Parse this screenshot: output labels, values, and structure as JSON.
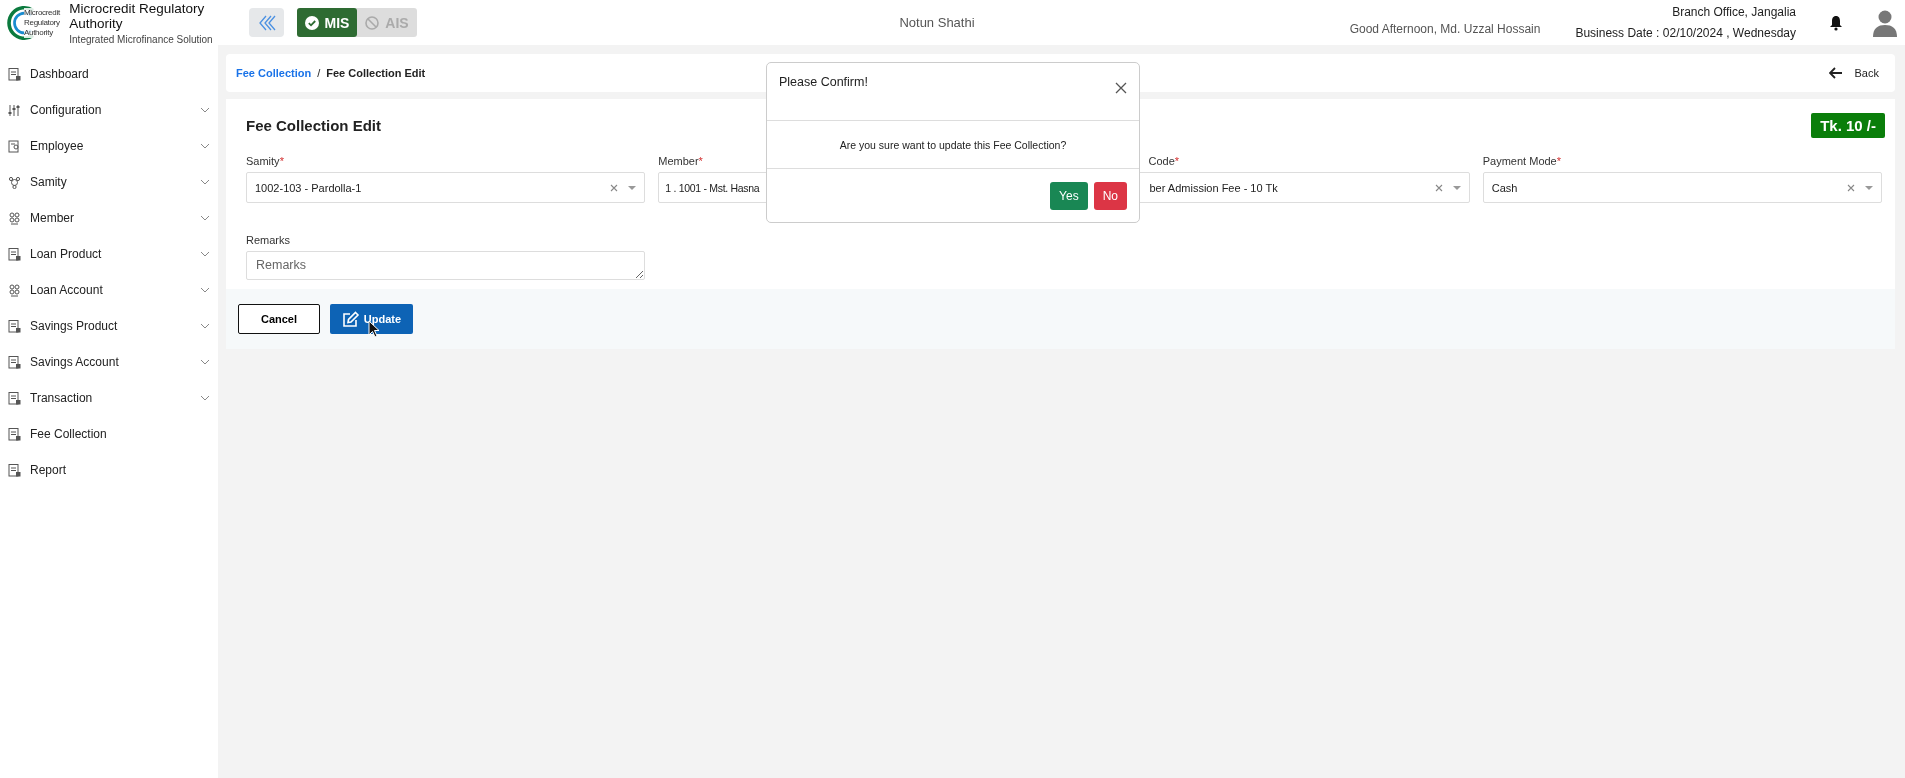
{
  "header": {
    "logo_lines": [
      "Microcredit",
      "Regulatory",
      "Authority"
    ],
    "title": "Microcredit Regulatory Authority",
    "subtitle": "Integrated Microfinance Solution",
    "modules": [
      {
        "label": "MIS",
        "selected": true
      },
      {
        "label": "AIS",
        "selected": false
      }
    ],
    "app_name": "Notun Shathi",
    "greeting": "Good Afternoon, Md. Uzzal Hossain",
    "branch": "Branch Office, Jangalia",
    "business_date": "Business Date : 02/10/2024 , Wednesday"
  },
  "sidebar": {
    "items": [
      {
        "label": "Dashboard",
        "expandable": false
      },
      {
        "label": "Configuration",
        "expandable": true
      },
      {
        "label": "Employee",
        "expandable": true
      },
      {
        "label": "Samity",
        "expandable": true
      },
      {
        "label": "Member",
        "expandable": true
      },
      {
        "label": "Loan Product",
        "expandable": true
      },
      {
        "label": "Loan Account",
        "expandable": true
      },
      {
        "label": "Savings Product",
        "expandable": true
      },
      {
        "label": "Savings Account",
        "expandable": true
      },
      {
        "label": "Transaction",
        "expandable": true
      },
      {
        "label": "Fee Collection",
        "expandable": false
      },
      {
        "label": "Report",
        "expandable": false
      }
    ]
  },
  "breadcrumb": {
    "link": "Fee Collection",
    "separator": "/",
    "current": "Fee Collection Edit",
    "back": "Back"
  },
  "form": {
    "title": "Fee Collection Edit",
    "amount": "Tk. 10 /-",
    "fields": [
      {
        "label": "Samity",
        "required": true,
        "required_mark": "*",
        "value": "1002-103 - Pardolla-1",
        "clearable": true
      },
      {
        "label": "Member",
        "required": true,
        "required_mark": "*",
        "value": "1 . 1001 - Mst. Hasna",
        "clearable": false
      },
      {
        "label": "Code",
        "required": true,
        "required_mark": "*",
        "value": "ber Admission Fee - 10 Tk",
        "clearable": true
      },
      {
        "label": "Payment Mode",
        "required": true,
        "required_mark": "*",
        "value": "Cash",
        "clearable": true
      }
    ],
    "remarks": {
      "label": "Remarks",
      "placeholder": "Remarks"
    },
    "cancel": "Cancel",
    "update": "Update"
  },
  "dialog": {
    "title": "Please Confirm!",
    "message": "Are you sure want to update this Fee Collection?",
    "yes": "Yes",
    "no": "No"
  }
}
